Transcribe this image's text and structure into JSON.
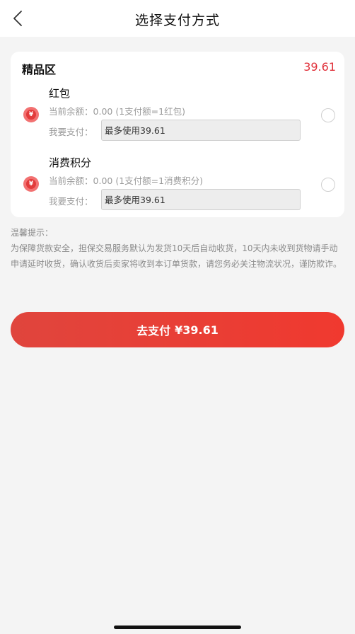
{
  "header": {
    "title": "选择支付方式"
  },
  "section": {
    "title": "精品区",
    "amount": "39.61"
  },
  "payment_methods": [
    {
      "name": "红包",
      "coin_symbol": "¥",
      "balance_label": "当前余额：",
      "balance": "0.00",
      "rate_note": "(1支付额=1红包)",
      "use_label": "我要支付：",
      "input_placeholder": "最多使用39.61",
      "selected": false
    },
    {
      "name": "消费积分",
      "coin_symbol": "¥",
      "balance_label": "当前余额：",
      "balance": "0.00",
      "rate_note": "(1支付额=1消费积分)",
      "use_label": "我要支付：",
      "input_placeholder": "最多使用39.61",
      "selected": false
    }
  ],
  "tips": {
    "heading": "温馨提示：",
    "body": "为保障货款安全，担保交易服务默认为发货10天后自动收货，10天内未收到货物请手动申请延时收货，确认收货后卖家将收到本订单货款，请您务必关注物流状况，谨防欺诈。"
  },
  "pay_button": {
    "label": "去支付",
    "amount": "¥39.61"
  },
  "icons": {
    "back": "chevron-left-icon",
    "coin": "yuan-coin-icon",
    "radio": "radio-unchecked-icon"
  },
  "colors": {
    "accent": "#e0303a",
    "button": "#ef3d33",
    "background": "#f4f4f4"
  }
}
